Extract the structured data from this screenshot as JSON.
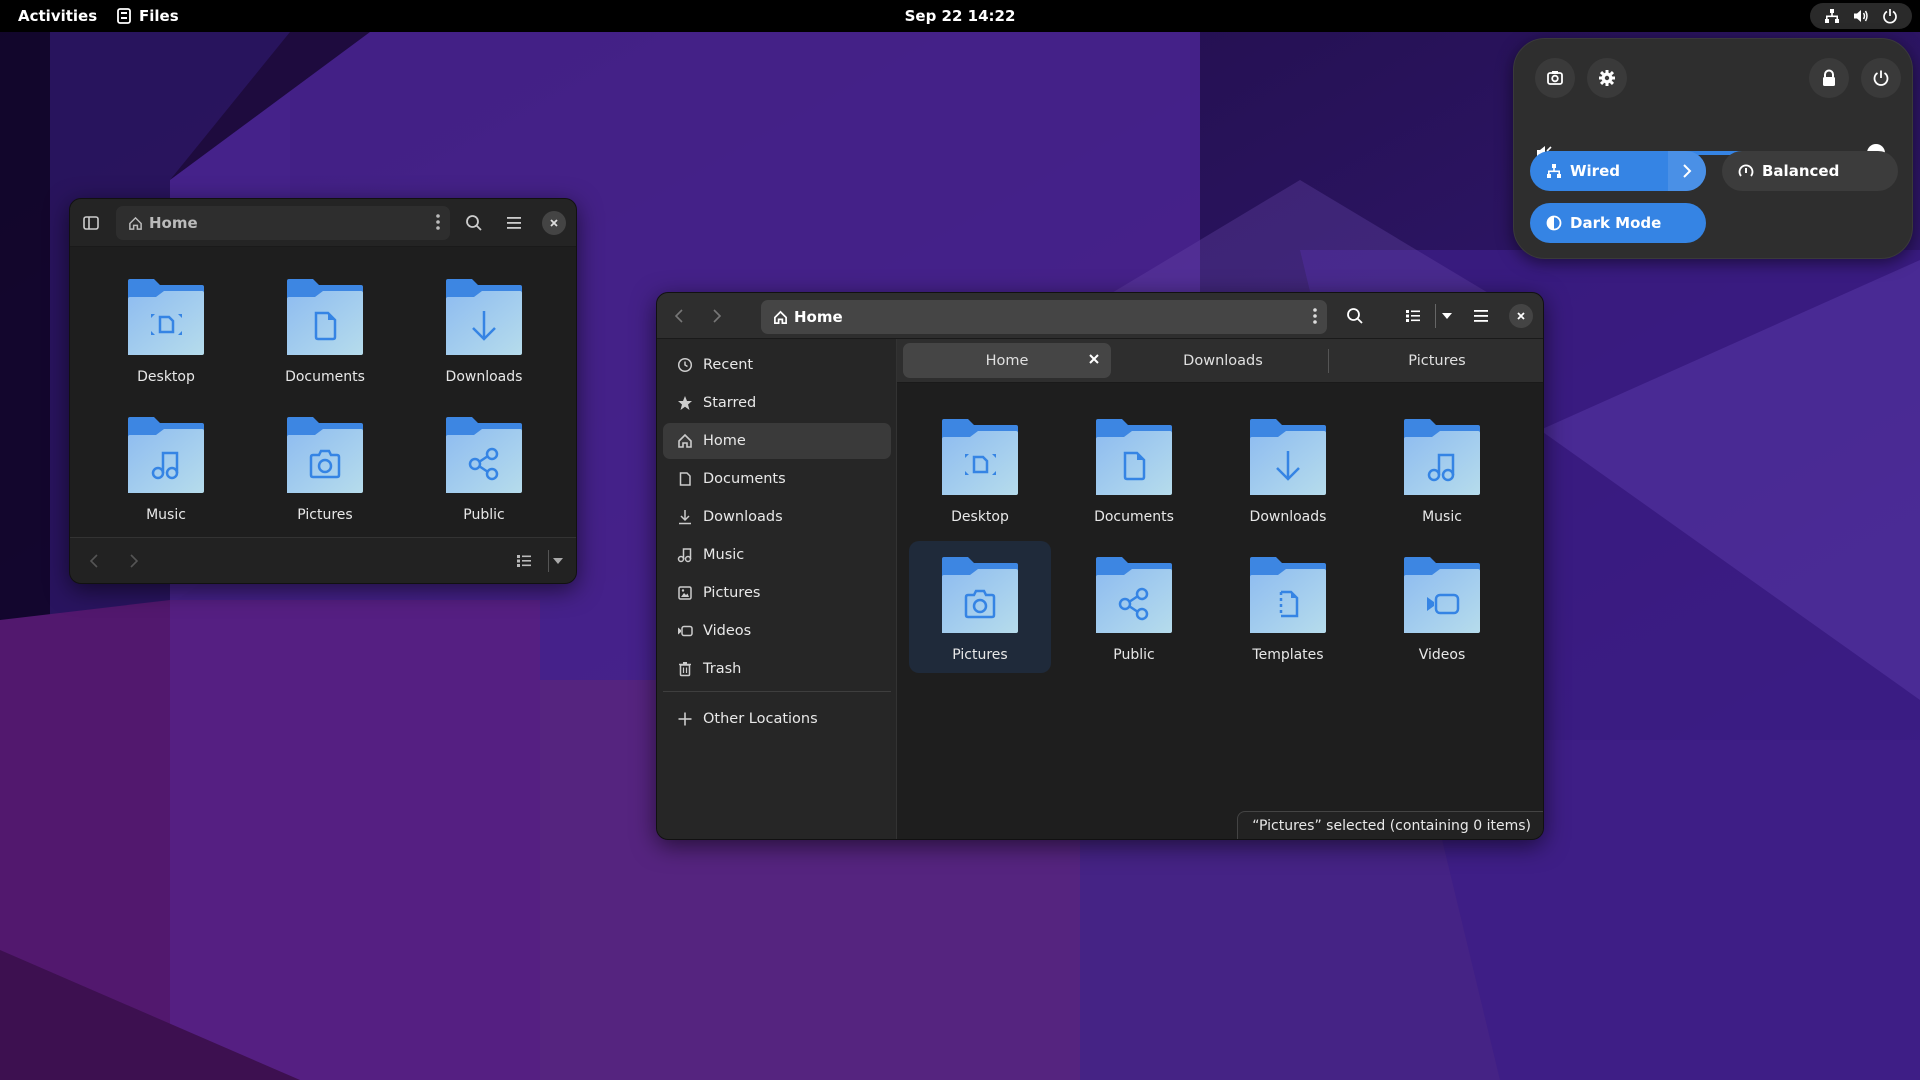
{
  "topbar": {
    "activities": "Activities",
    "app_name": "Files",
    "clock": "Sep 22  14:22"
  },
  "quick_settings": {
    "volume_fraction": 1.0,
    "wired_label": "Wired",
    "power_mode_label": "Balanced",
    "dark_mode_label": "Dark Mode",
    "accent_color": "#3584e4"
  },
  "small_window": {
    "path": "Home",
    "items": [
      {
        "label": "Desktop",
        "icon": "desktop"
      },
      {
        "label": "Documents",
        "icon": "document"
      },
      {
        "label": "Downloads",
        "icon": "download"
      },
      {
        "label": "Music",
        "icon": "music"
      },
      {
        "label": "Pictures",
        "icon": "camera"
      },
      {
        "label": "Public",
        "icon": "share"
      }
    ]
  },
  "large_window": {
    "path": "Home",
    "sidebar": {
      "items": [
        {
          "label": "Recent",
          "icon": "clock"
        },
        {
          "label": "Starred",
          "icon": "star"
        },
        {
          "label": "Home",
          "icon": "home",
          "active": true
        },
        {
          "label": "Documents",
          "icon": "document"
        },
        {
          "label": "Downloads",
          "icon": "download"
        },
        {
          "label": "Music",
          "icon": "music"
        },
        {
          "label": "Pictures",
          "icon": "picture"
        },
        {
          "label": "Videos",
          "icon": "video"
        },
        {
          "label": "Trash",
          "icon": "trash"
        }
      ],
      "other_locations": "Other Locations"
    },
    "tabs": [
      {
        "label": "Home",
        "active": true
      },
      {
        "label": "Downloads"
      },
      {
        "label": "Pictures"
      }
    ],
    "items": [
      {
        "label": "Desktop",
        "icon": "desktop"
      },
      {
        "label": "Documents",
        "icon": "document"
      },
      {
        "label": "Downloads",
        "icon": "download"
      },
      {
        "label": "Music",
        "icon": "music"
      },
      {
        "label": "Pictures",
        "icon": "camera",
        "selected": true
      },
      {
        "label": "Public",
        "icon": "share"
      },
      {
        "label": "Templates",
        "icon": "template"
      },
      {
        "label": "Videos",
        "icon": "video"
      }
    ],
    "status": "“Pictures” selected  (containing 0 items)"
  }
}
